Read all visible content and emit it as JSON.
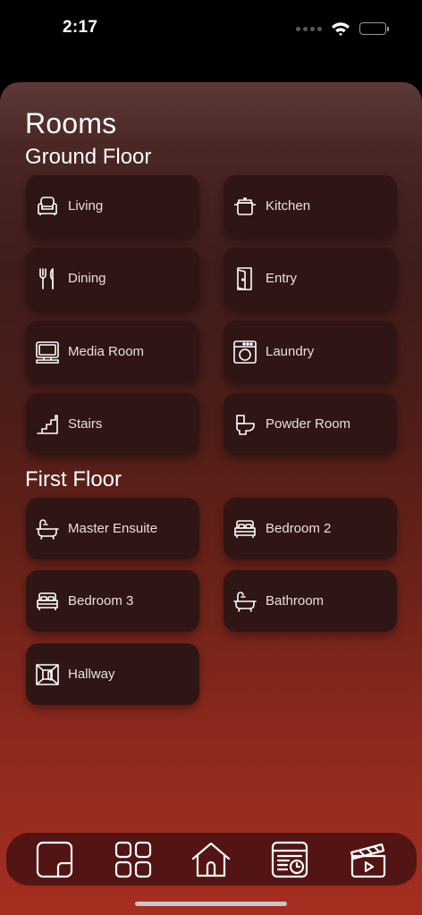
{
  "status": {
    "time": "2:17"
  },
  "page": {
    "title": "Rooms"
  },
  "sections": [
    {
      "title": "Ground Floor",
      "rooms": [
        {
          "label": "Living",
          "icon": "armchair-icon"
        },
        {
          "label": "Kitchen",
          "icon": "cooking-pot-icon"
        },
        {
          "label": "Dining",
          "icon": "fork-knife-icon"
        },
        {
          "label": "Entry",
          "icon": "door-icon"
        },
        {
          "label": "Media Room",
          "icon": "computer-monitor-icon"
        },
        {
          "label": "Laundry",
          "icon": "washing-machine-icon"
        },
        {
          "label": "Stairs",
          "icon": "stairs-icon"
        },
        {
          "label": "Powder Room",
          "icon": "toilet-icon"
        }
      ]
    },
    {
      "title": "First Floor",
      "rooms": [
        {
          "label": "Master Ensuite",
          "icon": "bathtub-icon"
        },
        {
          "label": "Bedroom 2",
          "icon": "bed-icon"
        },
        {
          "label": "Bedroom 3",
          "icon": "bed-icon"
        },
        {
          "label": "Bathroom",
          "icon": "bathtub-icon"
        },
        {
          "label": "Hallway",
          "icon": "hallway-icon"
        }
      ]
    }
  ],
  "tabbar": {
    "tabs": [
      {
        "icon": "floor-plan-icon"
      },
      {
        "icon": "grid-icon"
      },
      {
        "icon": "house-icon"
      },
      {
        "icon": "schedule-icon"
      },
      {
        "icon": "scene-clapper-icon"
      }
    ]
  },
  "colors": {
    "tile_background": "#2f1514",
    "tab_bar_background": "#521513",
    "accent_red": "#a62e20"
  }
}
